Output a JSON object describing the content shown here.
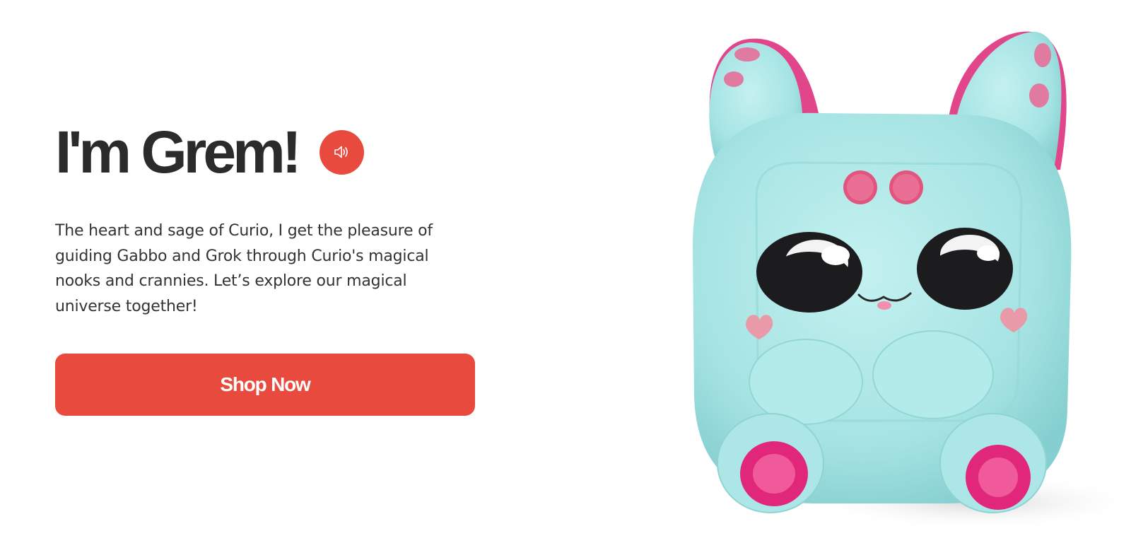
{
  "hero": {
    "title": "I'm Grem!",
    "description": "The heart and sage of Curio, I get the pleasure of guiding Gabbo and Grok through Curio's magical nooks and crannies. Let’s explore our magical universe together!",
    "sound_icon": "speaker-icon",
    "cta_label": "Shop Now"
  },
  "product_image": {
    "subject": "plush-toy-icon"
  },
  "colors": {
    "accent": "#e84b3d",
    "title_text": "#2b2b2b",
    "body_text": "#333333",
    "plush_body": "#a8e6e6",
    "plush_accent": "#e0457b"
  }
}
